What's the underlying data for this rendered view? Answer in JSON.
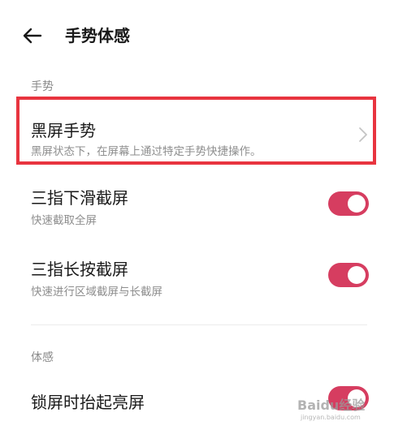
{
  "header": {
    "title": "手势体感",
    "back_icon": "arrow-left-icon"
  },
  "sections": {
    "gesture": "手势",
    "motion": "体感"
  },
  "items": [
    {
      "title": "黑屏手势",
      "subtitle": "黑屏状态下，在屏幕上通过特定手势快捷操作。",
      "control": "chevron"
    },
    {
      "title": "三指下滑截屏",
      "subtitle": "快速截取全屏",
      "control": "toggle",
      "on": true
    },
    {
      "title": "三指长按截屏",
      "subtitle": "快速进行区域截屏与长截屏",
      "control": "toggle",
      "on": true
    },
    {
      "title": "锁屏时抬起亮屏",
      "subtitle": "",
      "control": "toggle",
      "on": true
    }
  ],
  "watermark": {
    "line1": "Baidu经验",
    "line2": "jingyan.baidu.com"
  },
  "colors": {
    "toggle_on": "#d63d60",
    "highlight": "#e8343f"
  }
}
